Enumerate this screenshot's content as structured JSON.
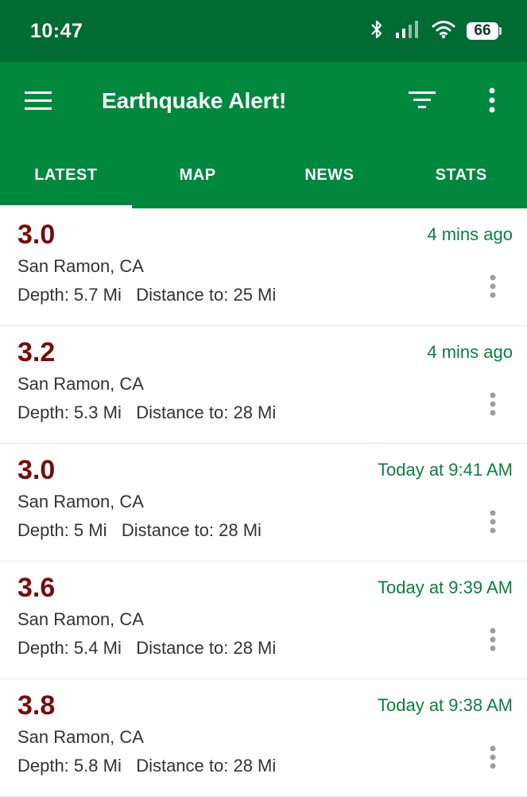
{
  "status_bar": {
    "time": "10:47",
    "battery": "66"
  },
  "app_bar": {
    "title": "Earthquake Alert!"
  },
  "tabs": [
    {
      "label": "LATEST",
      "active": true
    },
    {
      "label": "MAP",
      "active": false
    },
    {
      "label": "NEWS",
      "active": false
    },
    {
      "label": "STATS",
      "active": false
    }
  ],
  "quakes": [
    {
      "magnitude": "3.0",
      "time": "4 mins ago",
      "place": "San Ramon, CA",
      "depth": "Depth: 5.7 Mi",
      "distance": "Distance to: 25 Mi"
    },
    {
      "magnitude": "3.2",
      "time": "4 mins ago",
      "place": "San Ramon, CA",
      "depth": "Depth: 5.3 Mi",
      "distance": "Distance to: 28 Mi"
    },
    {
      "magnitude": "3.0",
      "time": "Today at 9:41 AM",
      "place": "San Ramon, CA",
      "depth": "Depth: 5 Mi",
      "distance": "Distance to: 28 Mi"
    },
    {
      "magnitude": "3.6",
      "time": "Today at 9:39 AM",
      "place": "San Ramon, CA",
      "depth": "Depth: 5.4 Mi",
      "distance": "Distance to: 28 Mi"
    },
    {
      "magnitude": "3.8",
      "time": "Today at 9:38 AM",
      "place": "San Ramon, CA",
      "depth": "Depth: 5.8 Mi",
      "distance": "Distance to: 28 Mi"
    }
  ],
  "colors": {
    "status_bar": "#006b33",
    "app_bar": "#00883f",
    "magnitude": "#7a0a0a",
    "time": "#0a8040"
  },
  "icons": [
    "bluetooth-icon",
    "signal-icon",
    "wifi-icon",
    "battery-icon",
    "menu-icon",
    "filter-icon",
    "more-vert-icon"
  ]
}
